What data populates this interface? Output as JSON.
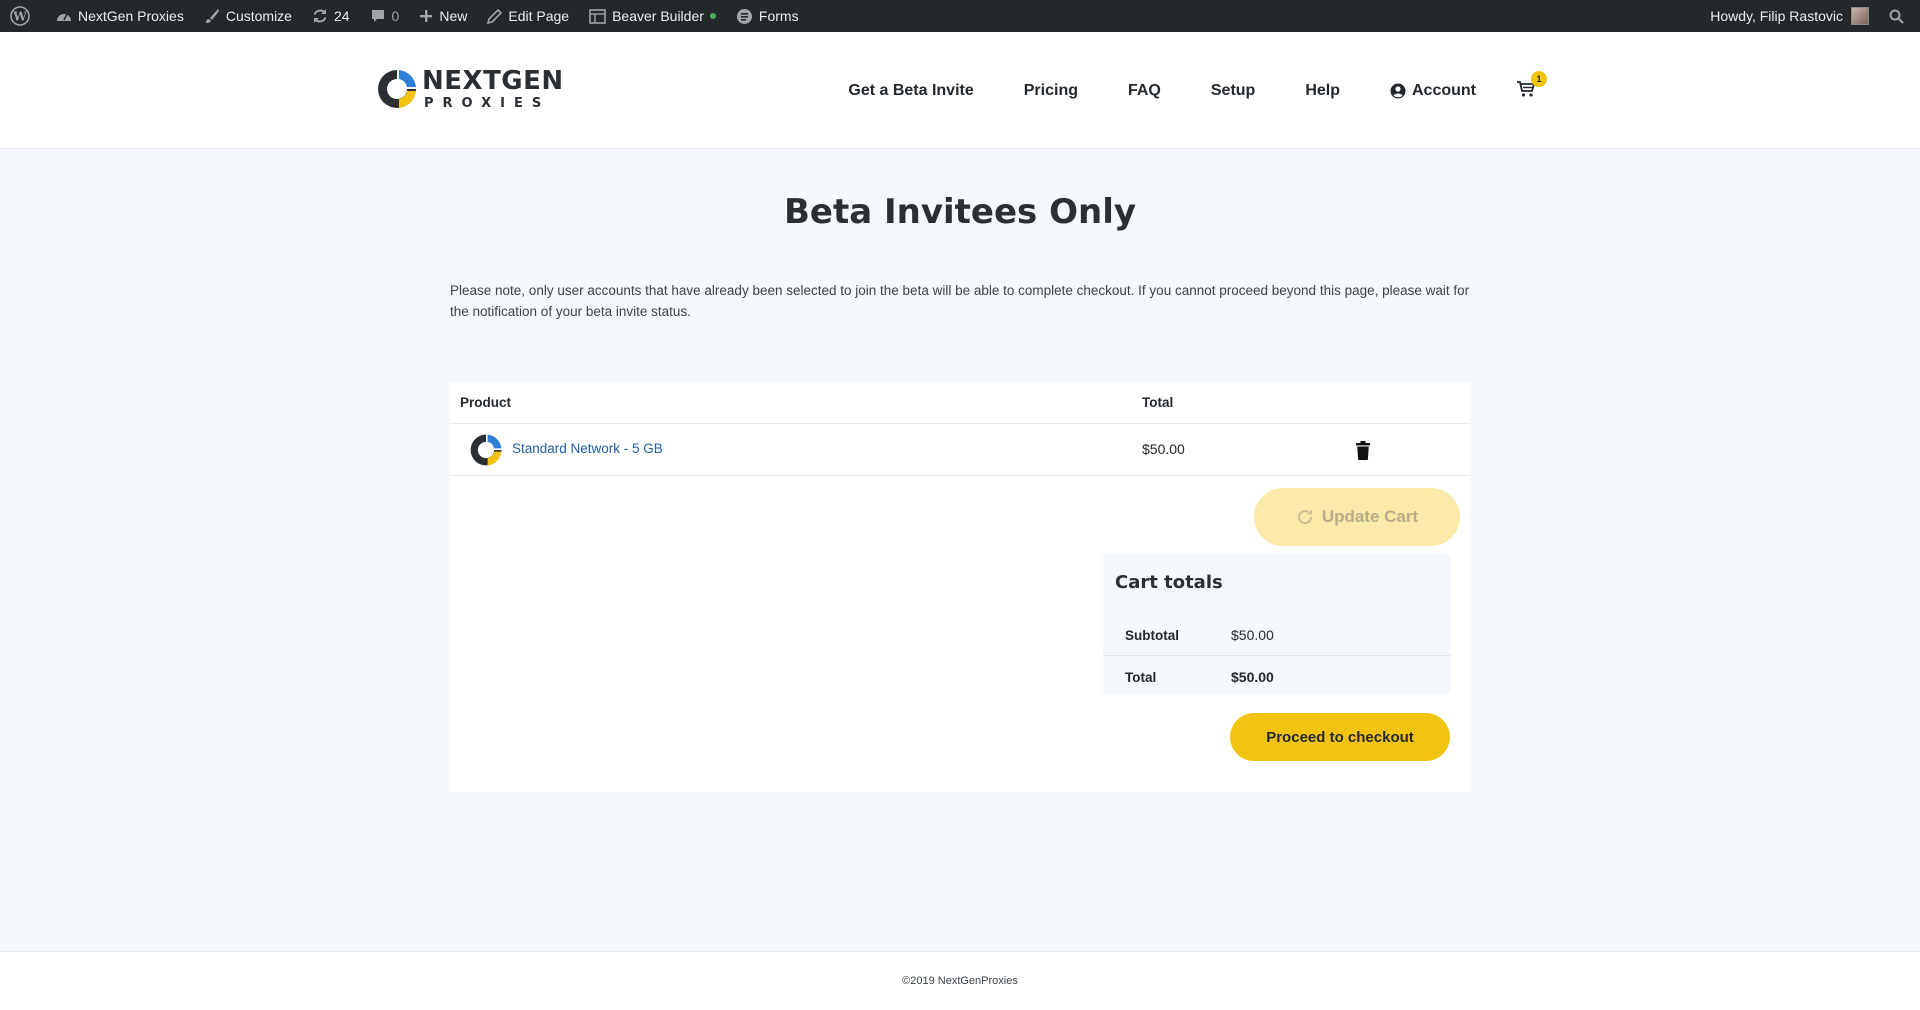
{
  "adminbar": {
    "site_name": "NextGen Proxies",
    "customize": "Customize",
    "updates_count": "24",
    "comments_count": "0",
    "new": "New",
    "edit_page": "Edit Page",
    "beaver_builder": "Beaver Builder",
    "forms": "Forms",
    "greeting": "Howdy, Filip Rastovic"
  },
  "logo": {
    "top": "NEXTGEN",
    "bottom": "PROXIES"
  },
  "nav": {
    "items": [
      "Get a Beta Invite",
      "Pricing",
      "FAQ",
      "Setup",
      "Help"
    ],
    "account": "Account",
    "cart_count": "1"
  },
  "page": {
    "title": "Beta Invitees Only",
    "note": "Please note, only user accounts that have already been selected to join the beta will be able to complete checkout. If you cannot proceed beyond this page, please wait for the notification of your beta invite status."
  },
  "cart": {
    "headers": {
      "product": "Product",
      "total": "Total"
    },
    "items": [
      {
        "name": "Standard Network - 5 GB",
        "total": "$50.00"
      }
    ],
    "update_label": "Update Cart"
  },
  "totals": {
    "title": "Cart totals",
    "subtotal_label": "Subtotal",
    "subtotal": "$50.00",
    "total_label": "Total",
    "total": "$50.00",
    "checkout_label": "Proceed to checkout"
  },
  "footer": {
    "text": "©2019 NextGenProxies"
  },
  "colors": {
    "accent": "#f2c40f",
    "link": "#1f5fa8",
    "adminbar": "#23282d",
    "brand_blue": "#2f7fd8"
  }
}
